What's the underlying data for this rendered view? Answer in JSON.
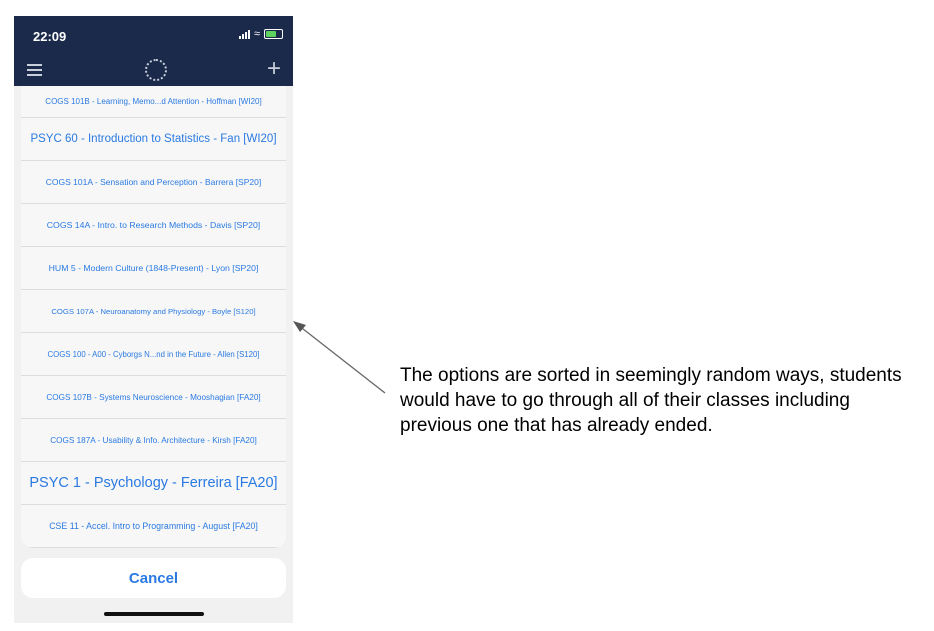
{
  "status_bar": {
    "time": "22:09"
  },
  "course_options": [
    {
      "label": "COGS 101B - Learning, Memo...d Attention - Hoffman [WI20]",
      "size": 8
    },
    {
      "label": "PSYC 60 - Introduction to Statistics - Fan [WI20]",
      "size": 11.5
    },
    {
      "label": "COGS 101A - Sensation and Perception - Barrera [SP20]",
      "size": 8.5
    },
    {
      "label": "COGS 14A - Intro. to Research Methods - Davis [SP20]",
      "size": 8.7
    },
    {
      "label": "HUM 5 - Modern Culture (1848-Present) - Lyon [SP20]",
      "size": 8.7
    },
    {
      "label": "COGS 107A - Neuroanatomy and Physiology - Boyle [S120]",
      "size": 7.7
    },
    {
      "label": "COGS 100 - A00 - Cyborgs N...nd in the Future - Allen [S120]",
      "size": 7.8
    },
    {
      "label": "COGS 107B - Systems Neuroscience - Mooshagian [FA20]",
      "size": 8.2
    },
    {
      "label": "COGS 187A - Usability & Info. Architecture - Kirsh [FA20]",
      "size": 8.2
    },
    {
      "label": "PSYC 1 - Psychology - Ferreira [FA20]",
      "size": 14.5
    },
    {
      "label": "CSE 11 - Accel. Intro to Programming - August [FA20]",
      "size": 8.8
    }
  ],
  "cancel_label": "Cancel",
  "annotation": "The options are sorted in seemingly random ways, students would have to go through all of their classes including previous one that has already ended."
}
